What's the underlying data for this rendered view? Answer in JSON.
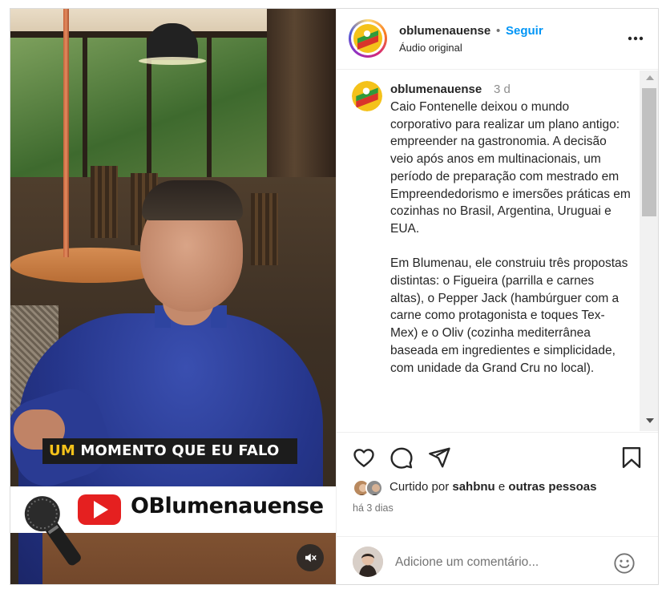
{
  "video": {
    "caption_accent": "UM",
    "caption_rest": " MOMENTO QUE EU FALO",
    "brand_name": "OBlumenauense",
    "mute_icon": "muted-speaker-icon"
  },
  "header": {
    "username": "oblumenauense",
    "dot": "•",
    "follow_label": "Seguir",
    "audio_label": "Áudio original",
    "more_icon": "more-options-icon"
  },
  "caption": {
    "username": "oblumenauense",
    "time": "3 d",
    "text": "Caio Fontenelle deixou o mundo corporativo para realizar um plano antigo: empreender na gastronomia. A decisão veio após anos em multinacionais, um período de preparação com mestrado em Empreendedorismo e imersões práticas em cozinhas no Brasil, Argentina, Uruguai e EUA.\n\nEm Blumenau, ele construiu três propostas distintas: o Figueira (parrilla e carnes altas), o Pepper Jack (hambúrguer com a carne como protagonista e toques Tex-Mex) e o Oliv (cozinha mediterrânea baseada em ingredientes e simplicidade, com unidade da Grand Cru no local)."
  },
  "actions": {
    "like_icon": "heart-icon",
    "comment_icon": "comment-icon",
    "share_icon": "send-icon",
    "save_icon": "bookmark-icon",
    "likes_prefix": "Curtido por ",
    "likes_user": "sahbnu",
    "likes_middle": " e ",
    "likes_others": "outras pessoas",
    "date": "há 3 dias"
  },
  "composer": {
    "placeholder": "Adicione um comentário...",
    "emoji_icon": "emoji-icon"
  },
  "colors": {
    "accent_blue": "#0095f6",
    "caption_yellow": "#f4c21a",
    "youtube_red": "#e52020"
  }
}
